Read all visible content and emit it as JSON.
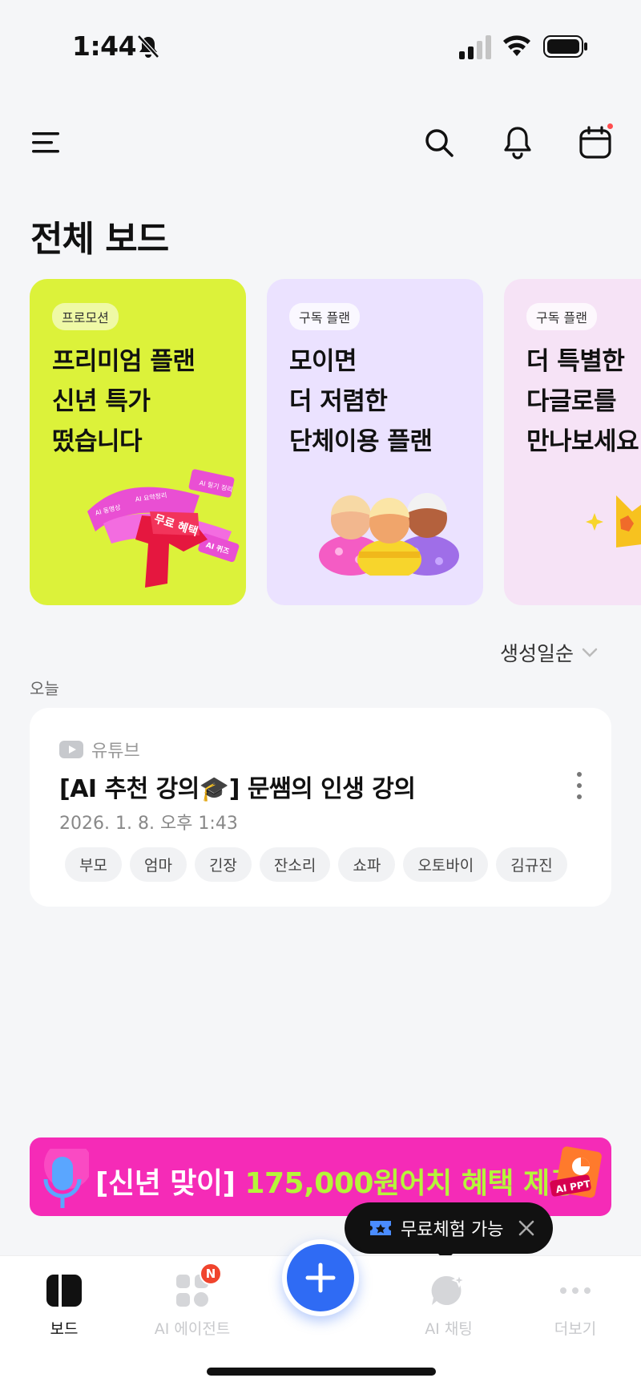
{
  "status_bar": {
    "time": "1:44"
  },
  "header": {
    "title": "전체 보드",
    "icons": [
      "menu-icon",
      "search-icon",
      "bell-icon",
      "calendar-icon"
    ],
    "calendar_badge_color": "#ff4d4f"
  },
  "cards": [
    {
      "tag": "프로모션",
      "line1": "프리미엄 플랜",
      "line2": "신년 특가",
      "line3": "떴습니다",
      "bg": "#dcf23a",
      "illustration_text": [
        "무료 혜택",
        "AI 퀴즈",
        "AI 동영상",
        "AI 요약정리",
        "AI 필기 정리"
      ]
    },
    {
      "tag": "구독 플랜",
      "line1": "모이면",
      "line2": "더 저렴한",
      "line3": "단체이용 플랜",
      "bg": "#ebe2ff"
    },
    {
      "tag": "구독 플랜",
      "line1": "더 특별한",
      "line2": "다글로를",
      "line3": "만나보세요",
      "bg": "#f6e3f6"
    }
  ],
  "sort": {
    "label": "생성일순"
  },
  "section": {
    "label": "오늘"
  },
  "board_item": {
    "source": "유튜브",
    "title": "[AI 추천 강의🎓] 문쌤의 인생 강의",
    "date": "2026. 1. 8. 오후 1:43",
    "tags": [
      "부모",
      "엄마",
      "긴장",
      "잔소리",
      "쇼파",
      "오토바이",
      "김규진"
    ]
  },
  "banner": {
    "text_part1": "[신년 맞이] ",
    "text_part2": "175,000원어치 혜택 제공",
    "badge": "AI PPT"
  },
  "tooltip": {
    "text": "무료체험 가능"
  },
  "tabs": {
    "board": "보드",
    "agent": "AI 에이전트",
    "agent_badge": "N",
    "chat": "AI 채팅",
    "more": "더보기"
  },
  "colors": {
    "accent": "#2f6bf4",
    "banner_bg": "#f52bb7",
    "banner_highlight": "#b5f53a"
  }
}
